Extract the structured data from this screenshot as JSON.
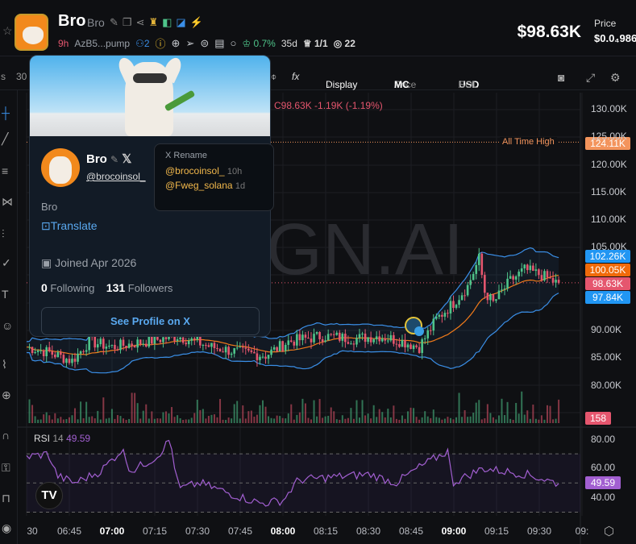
{
  "header": {
    "name": "Bro",
    "ticker": "Bro",
    "age": "9h",
    "address": "AzB5...pump",
    "holders": "2",
    "top10": "0.7%",
    "top10_age": "35d",
    "ratio": "1/1",
    "watchers": "22",
    "market_cap": "$98.63K",
    "price_label": "Price",
    "price_value": "$0.0₄986"
  },
  "toolbar": {
    "left_frag": "s",
    "interval_frag": "30",
    "fx": "fx",
    "display": "Display",
    "price": "Price",
    "mc": "MC",
    "usd": "USD",
    "sol": "SOL"
  },
  "popup": {
    "name": "Bro",
    "handle": "@brocoinsol_",
    "bio": "Bro",
    "translate": "Translate",
    "joined": "Joined Apr 2026",
    "following_count": "0",
    "following_label": "Following",
    "followers_count": "131",
    "followers_label": "Followers",
    "see_profile": "See Profile on X",
    "rename": {
      "title": "X Rename",
      "items": [
        {
          "handle": "@brocoinsol_",
          "age": "10h"
        },
        {
          "handle": "@Fweg_solana",
          "age": "1d"
        }
      ]
    }
  },
  "chart": {
    "ohlc_text": "C98.63K  -1.19K (-1.19%)",
    "watermark": "GN.AI",
    "ath_label": "All Time High",
    "ath_value": "124.11K",
    "y_ticks": [
      "130.00K",
      "125.00K",
      "120.00K",
      "115.00K",
      "110.00K",
      "105.00K",
      "90.00K",
      "85.00K",
      "80.00K"
    ],
    "tags": {
      "bb_upper": "102.26K",
      "ma": "100.05K",
      "last": "98.63K",
      "bb_lower": "97.84K",
      "volume": "158"
    },
    "rsi": {
      "label": "RSI",
      "period": "14",
      "value": "49.59",
      "ticks": [
        "80.00",
        "60.00",
        "40.00"
      ]
    },
    "x_ticks": [
      "30",
      "06:45",
      "07:00",
      "07:15",
      "07:30",
      "07:45",
      "08:00",
      "08:15",
      "08:30",
      "08:45",
      "09:00",
      "09:15",
      "09:30",
      "09:"
    ],
    "price_keypoints_k": [
      [
        0,
        87
      ],
      [
        8,
        86
      ],
      [
        16,
        84.5
      ],
      [
        22,
        88
      ],
      [
        30,
        87
      ],
      [
        42,
        88
      ],
      [
        53,
        89
      ],
      [
        65,
        87
      ],
      [
        75,
        86
      ],
      [
        84,
        85.5
      ],
      [
        92,
        88
      ],
      [
        104,
        89
      ],
      [
        115,
        88.5
      ],
      [
        124,
        89
      ],
      [
        132,
        88
      ],
      [
        138,
        87
      ],
      [
        144,
        92
      ],
      [
        150,
        95
      ],
      [
        155,
        98
      ],
      [
        159,
        103
      ],
      [
        161,
        97
      ],
      [
        164,
        95
      ],
      [
        170,
        99
      ],
      [
        175,
        101
      ],
      [
        181,
        100
      ],
      [
        186,
        98.63
      ]
    ],
    "rsi_keypoints": [
      [
        0,
        68
      ],
      [
        10,
        70
      ],
      [
        14,
        55
      ],
      [
        22,
        50
      ],
      [
        34,
        58
      ],
      [
        44,
        73
      ],
      [
        48,
        58
      ],
      [
        60,
        68
      ],
      [
        66,
        80
      ],
      [
        70,
        46
      ],
      [
        80,
        50
      ],
      [
        95,
        42
      ],
      [
        108,
        36
      ],
      [
        118,
        38
      ],
      [
        125,
        52
      ],
      [
        140,
        54
      ],
      [
        158,
        56
      ],
      [
        170,
        50
      ],
      [
        180,
        60
      ],
      [
        194,
        72
      ],
      [
        196,
        50
      ],
      [
        210,
        60
      ],
      [
        230,
        56
      ],
      [
        245,
        49.59
      ]
    ],
    "colors": {
      "up": "#4fc48a",
      "down": "#e5566e",
      "band": "#3a8ee6",
      "ma": "#f07a1a",
      "rsi": "#a25fd1",
      "ath": "#f3945c"
    }
  }
}
